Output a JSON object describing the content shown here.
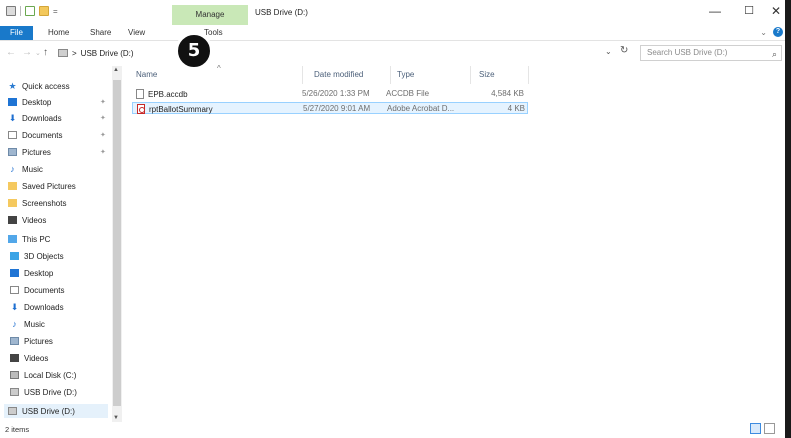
{
  "title_bar": {
    "manage_tab": "Manage",
    "window_title": "USB Drive (D:)",
    "minimize": "—",
    "maximize": "☐",
    "close": "✕"
  },
  "ribbon": {
    "tabs": {
      "file": "File",
      "home": "Home",
      "share": "Share",
      "view": "View",
      "drive_tools": "Tools"
    },
    "collapse": "⌄",
    "help": "?"
  },
  "address_bar": {
    "back": "←",
    "forward": "→",
    "recent": "⌄",
    "up": "↑",
    "separator": ">",
    "location": "USB Drive (D:)",
    "dropdown": "⌄",
    "refresh": "↻",
    "search_placeholder": "Search USB Drive (D:)",
    "search_icon": "⌕"
  },
  "step_badge": "5",
  "navigation": {
    "quick_access": [
      {
        "label": "Quick access",
        "icon": "star-icon",
        "pinned": false
      },
      {
        "label": "Desktop",
        "icon": "desktop-icon",
        "pinned": true
      },
      {
        "label": "Downloads",
        "icon": "download-icon",
        "pinned": true
      },
      {
        "label": "Documents",
        "icon": "documents-icon",
        "pinned": true
      },
      {
        "label": "Pictures",
        "icon": "pictures-icon",
        "pinned": true
      },
      {
        "label": "Music",
        "icon": "music-icon",
        "pinned": false
      },
      {
        "label": "Saved Pictures",
        "icon": "folder-icon",
        "pinned": false
      },
      {
        "label": "Screenshots",
        "icon": "folder-icon",
        "pinned": false
      },
      {
        "label": "Videos",
        "icon": "videos-icon",
        "pinned": false
      }
    ],
    "this_pc": [
      {
        "label": "This PC",
        "icon": "pc-icon"
      },
      {
        "label": "3D Objects",
        "icon": "3d-objects-icon"
      },
      {
        "label": "Desktop",
        "icon": "desktop-icon"
      },
      {
        "label": "Documents",
        "icon": "documents-icon"
      },
      {
        "label": "Downloads",
        "icon": "download-icon"
      },
      {
        "label": "Music",
        "icon": "music-icon"
      },
      {
        "label": "Pictures",
        "icon": "pictures-icon"
      },
      {
        "label": "Videos",
        "icon": "videos-icon"
      },
      {
        "label": "Local Disk (C:)",
        "icon": "local-disk-icon"
      },
      {
        "label": "USB Drive (D:)",
        "icon": "usb-drive-icon"
      }
    ],
    "drive": {
      "label": "USB Drive (D:)",
      "icon": "usb-drive-icon"
    },
    "pin_glyph": "✦"
  },
  "file_list": {
    "columns": {
      "name": "Name",
      "date": "Date modified",
      "type": "Type",
      "size": "Size"
    },
    "sort_glyph": "^",
    "rows": [
      {
        "name": "EPB.accdb",
        "date": "5/26/2020 1:33 PM",
        "type": "ACCDB File",
        "size": "4,584 KB",
        "icon": "file-icon",
        "selected": false
      },
      {
        "name": "rptBallotSummary",
        "date": "5/27/2020 9:01 AM",
        "type": "Adobe Acrobat D...",
        "size": "4 KB",
        "icon": "pdf-icon",
        "selected": true
      }
    ]
  },
  "status_bar": {
    "item_count": "2 items"
  }
}
